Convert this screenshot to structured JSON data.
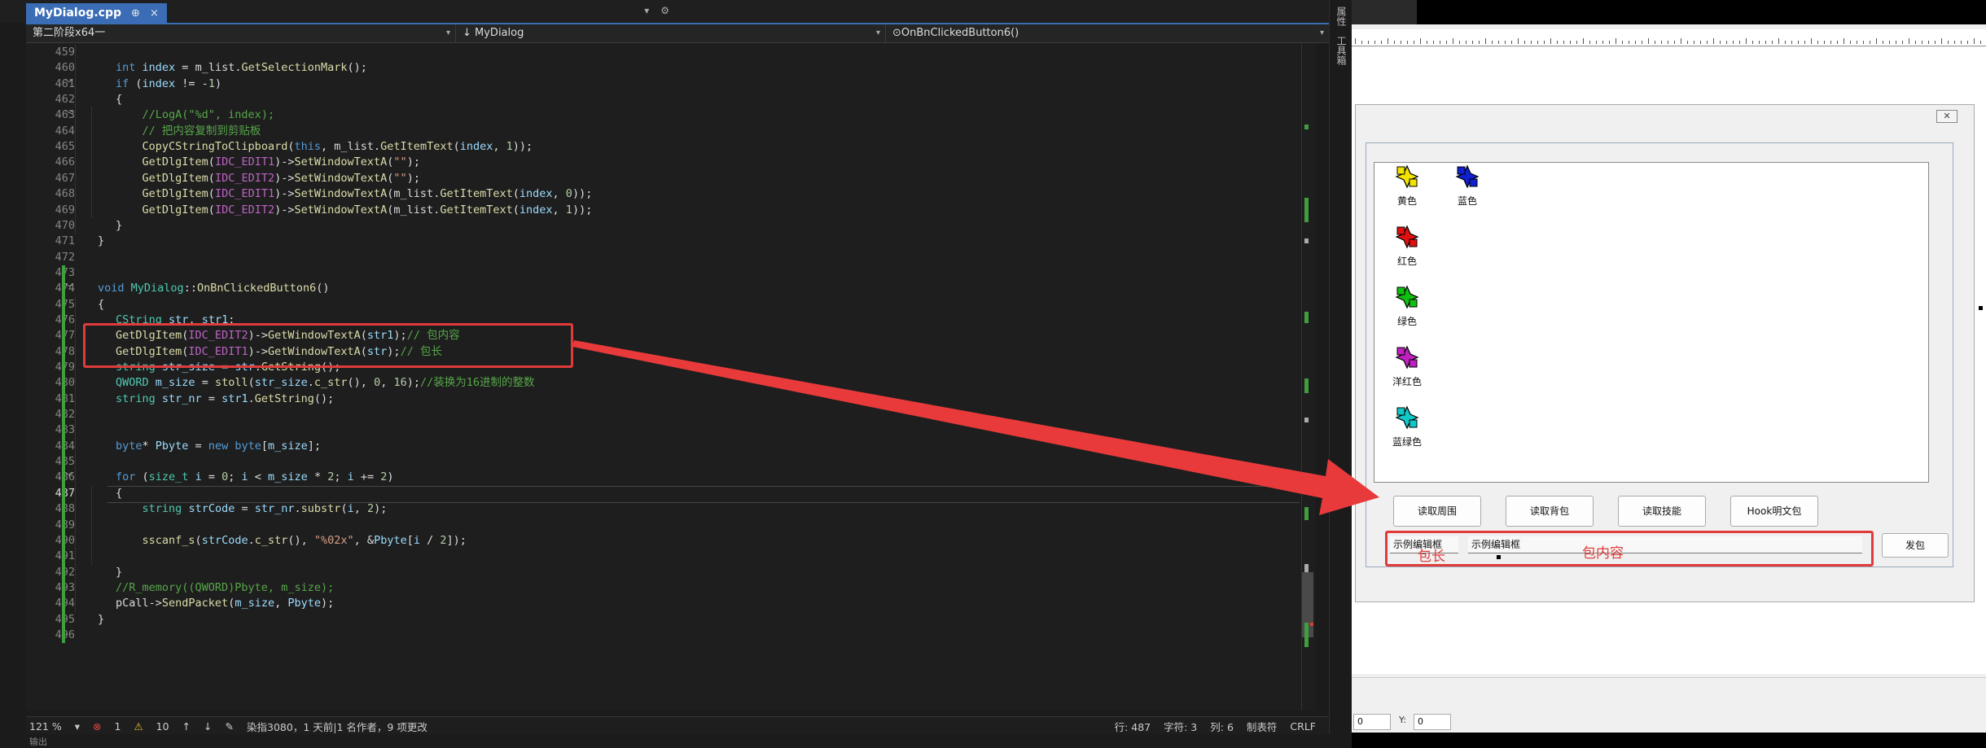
{
  "editor": {
    "tab_title": "MyDialog.cpp",
    "tab_pin": "⊕",
    "tab_close": "×",
    "tabstrip_right": [
      "▾",
      "⚙"
    ],
    "nav": {
      "project": "第二阶段x64一",
      "class": "↓ MyDialog",
      "method": "⊙OnBnClickedButton6()"
    }
  },
  "code_lines": [
    {
      "n": "459",
      "html": ""
    },
    {
      "n": "460",
      "html": "<span class='kw'>int</span> <span class='var'>index</span> = <span class='mem'>m_list</span>.<span class='fn'>GetSelectionMark</span>();"
    },
    {
      "n": "461",
      "html": "<span class='kw'>if</span> (<span class='var'>index</span> != -<span class='num'>1</span>)"
    },
    {
      "n": "462",
      "html": "{"
    },
    {
      "n": "463",
      "html": "    <span class='cm'>//LogA(\"%d\", index);</span>"
    },
    {
      "n": "464",
      "html": "    <span class='cm'>// 把内容复制到剪贴板</span>"
    },
    {
      "n": "465",
      "html": "    <span class='fn'>CopyCStringToClipboard</span>(<span class='kw'>this</span>, <span class='mem'>m_list</span>.<span class='fn'>GetItemText</span>(<span class='var'>index</span>, <span class='num'>1</span>));"
    },
    {
      "n": "466",
      "html": "    <span class='fn'>GetDlgItem</span>(<span class='mac'>IDC_EDIT1</span>)-&gt;<span class='fn'>SetWindowTextA</span>(<span class='str'>\"\"</span>);"
    },
    {
      "n": "467",
      "html": "    <span class='fn'>GetDlgItem</span>(<span class='mac'>IDC_EDIT2</span>)-&gt;<span class='fn'>SetWindowTextA</span>(<span class='str'>\"\"</span>);"
    },
    {
      "n": "468",
      "html": "    <span class='fn'>GetDlgItem</span>(<span class='mac'>IDC_EDIT1</span>)-&gt;<span class='fn'>SetWindowTextA</span>(<span class='mem'>m_list</span>.<span class='fn'>GetItemText</span>(<span class='var'>index</span>, <span class='num'>0</span>));"
    },
    {
      "n": "469",
      "html": "    <span class='fn'>GetDlgItem</span>(<span class='mac'>IDC_EDIT2</span>)-&gt;<span class='fn'>SetWindowTextA</span>(<span class='mem'>m_list</span>.<span class='fn'>GetItemText</span>(<span class='var'>index</span>, <span class='num'>1</span>));"
    },
    {
      "n": "470",
      "html": "}"
    },
    {
      "n": "471",
      "html": "}",
      "indent": -1
    },
    {
      "n": "472",
      "html": ""
    },
    {
      "n": "473",
      "html": ""
    },
    {
      "n": "474",
      "html": "<span class='kw'>void</span> <span class='ty'>MyDialog</span>::<span class='fn'>OnBnClickedButton6</span>()",
      "indent": -1
    },
    {
      "n": "475",
      "html": "{",
      "indent": -1
    },
    {
      "n": "476",
      "html": "<span class='ty'>CString</span> <span class='var'>str</span>, <span class='var'>str1</span>;"
    },
    {
      "n": "477",
      "html": "<span class='fn'>GetDlgItem</span>(<span class='mac'>IDC_EDIT2</span>)-&gt;<span class='fn'>GetWindowTextA</span>(<span class='var'>str1</span>);<span class='cm'>// 包内容</span>"
    },
    {
      "n": "478",
      "html": "<span class='fn'>GetDlgItem</span>(<span class='mac'>IDC_EDIT1</span>)-&gt;<span class='fn'>GetWindowTextA</span>(<span class='var'>str</span>);<span class='cm'>// 包长</span>"
    },
    {
      "n": "479",
      "html": "<span class='ty'>string</span> <span class='var'>str_size</span> = <span class='var'>str</span>.<span class='fn'>GetString</span>();"
    },
    {
      "n": "480",
      "html": "<span class='ty'>QWORD</span> <span class='var'>m_size</span> = <span class='fn'>stoll</span>(<span class='var'>str_size</span>.<span class='fn'>c_str</span>(), <span class='num'>0</span>, <span class='num'>16</span>);<span class='cm'>//装换为16进制的整数</span>"
    },
    {
      "n": "481",
      "html": "<span class='ty'>string</span> <span class='var'>str_nr</span> = <span class='var'>str1</span>.<span class='fn'>GetString</span>();"
    },
    {
      "n": "482",
      "html": ""
    },
    {
      "n": "483",
      "html": ""
    },
    {
      "n": "484",
      "html": "<span class='kw'>byte</span>* <span class='var'>Pbyte</span> = <span class='kw'>new</span> <span class='kw'>byte</span>[<span class='var'>m_size</span>];"
    },
    {
      "n": "485",
      "html": ""
    },
    {
      "n": "486",
      "html": "<span class='kw'>for</span> (<span class='ty'>size_t</span> <span class='var'>i</span> = <span class='num'>0</span>; <span class='var'>i</span> &lt; <span class='var'>m_size</span> * <span class='num'>2</span>; <span class='var'>i</span> += <span class='num'>2</span>)"
    },
    {
      "n": "487",
      "html": "{"
    },
    {
      "n": "488",
      "html": "    <span class='ty'>string</span> <span class='var'>strCode</span> = <span class='var'>str_nr</span>.<span class='fn'>substr</span>(<span class='var'>i</span>, <span class='num'>2</span>);"
    },
    {
      "n": "489",
      "html": ""
    },
    {
      "n": "490",
      "html": "    <span class='fn'>sscanf_s</span>(<span class='var'>strCode</span>.<span class='fn'>c_str</span>(), <span class='str'>\"%02x\"</span>, &amp;<span class='var'>Pbyte</span>[<span class='var'>i</span> / <span class='num'>2</span>]);"
    },
    {
      "n": "491",
      "html": ""
    },
    {
      "n": "492",
      "html": "}"
    },
    {
      "n": "493",
      "html": "<span class='cm'>//R_memory((QWORD)Pbyte, m_size);</span>"
    },
    {
      "n": "494",
      "html": "<span class='mem'>pCall</span>-&gt;<span class='fn'>SendPacket</span>(<span class='var'>m_size</span>, <span class='var'>Pbyte</span>);"
    },
    {
      "n": "495",
      "html": "}",
      "indent": -1
    },
    {
      "n": "496",
      "html": "",
      "indent": -1
    }
  ],
  "current_line": "487",
  "status": {
    "zoom": "121 %",
    "errors": "1",
    "warnings": "10",
    "git": "染指3080，1 天前|1 名作者，9 项更改",
    "row": "行: 487",
    "char": "字符: 3",
    "col": "列: 6",
    "tab_mode": "制表符",
    "eol": "CRLF"
  },
  "bottom_label": "输出",
  "side_tabs": [
    "属性",
    "工具箱"
  ],
  "dialog": {
    "close": "✕",
    "list_items": [
      {
        "label": "黄色",
        "color": "#f2e200"
      },
      {
        "label": "蓝色",
        "color": "#1020d0"
      },
      {
        "label": "红色",
        "color": "#e01010"
      },
      {
        "label": "绿色",
        "color": "#10c010"
      },
      {
        "label": "洋红色",
        "color": "#c020c0"
      },
      {
        "label": "蓝绿色",
        "color": "#10c8c8"
      }
    ],
    "buttons": [
      "读取周围",
      "读取背包",
      "读取技能",
      "Hook明文包"
    ],
    "edit1": "示例编辑框",
    "edit2": "示例编辑框",
    "send": "发包",
    "annot_len": "包长",
    "annot_content": "包内容",
    "spin_x": "0",
    "spin_y": "0",
    "spin_y_label": "Y:"
  },
  "colors": {
    "annotation": "#e03b3b",
    "accent": "#3a6db5"
  }
}
